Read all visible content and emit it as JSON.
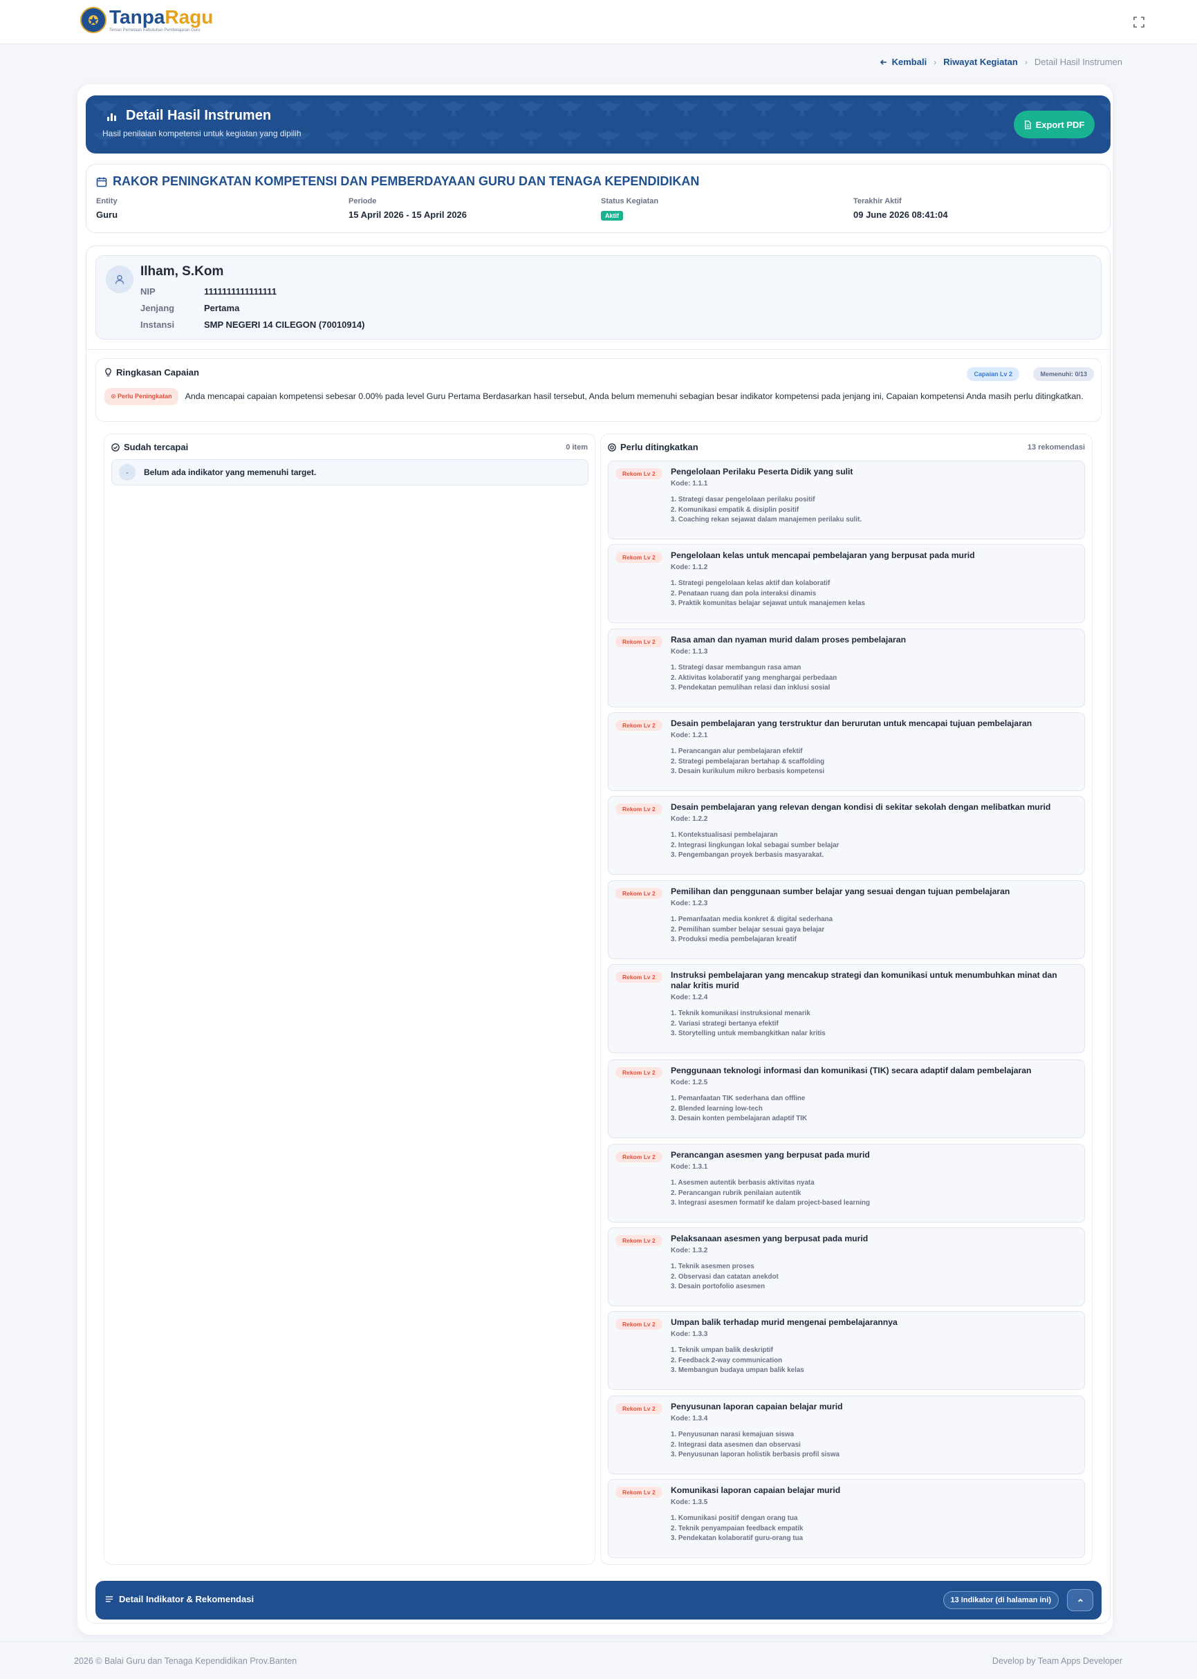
{
  "app": {
    "logo_part1": "Tanpa",
    "logo_part2": "Ragu",
    "logo_sub": "Teman Pemetaan Kebutuhan Pembelajaran Guru"
  },
  "breadcrumb": {
    "back": "Kembali",
    "link": "Riwayat Kegiatan",
    "current": "Detail Hasil Instrumen"
  },
  "banner": {
    "title": "Detail Hasil Instrumen",
    "subtitle": "Hasil penilaian kompetensi untuk kegiatan yang dipilih",
    "export_label": "Export PDF"
  },
  "event": {
    "title": "RAKOR PENINGKATAN KOMPETENSI DAN PEMBERDAYAAN GURU DAN TENAGA KEPENDIDIKAN",
    "entity_label": "Entity",
    "entity_value": "Guru",
    "periode_label": "Periode",
    "periode_value": "15 April 2026 - 15 April 2026",
    "status_label": "Status Kegiatan",
    "status_value": "Aktif",
    "terakhir_label": "Terakhir Aktif",
    "terakhir_value": "09 June 2026 08:41:04"
  },
  "profile": {
    "name": "Ilham, S.Kom",
    "nip_label": "NIP",
    "nip_value": "1111111111111111",
    "jenjang_label": "Jenjang",
    "jenjang_value": "Pertama",
    "instansi_label": "Instansi",
    "instansi_value": "SMP NEGERI 14 CILEGON (70010914)"
  },
  "summary": {
    "title": "Ringkasan Capaian",
    "capaian_pill": "Capaian Lv 2",
    "memenuhi_pill": "Memenuhi: 0/13",
    "status_pill": "Perlu Peningkatan",
    "text": "Anda mencapai capaian kompetensi sebesar 0.00% pada level Guru Pertama Berdasarkan hasil tersebut, Anda belum memenuhi sebagian besar indikator kompetensi pada jenjang ini, Capaian kompetensi Anda masih perlu ditingkatkan."
  },
  "achieved": {
    "title": "Sudah tercapai",
    "count": "0 item",
    "empty_mark": "-",
    "empty_text": "Belum ada indikator yang memenuhi target."
  },
  "improve": {
    "title": "Perlu ditingkatkan",
    "count": "13 rekomendasi",
    "items": [
      {
        "badge": "Rekom Lv 2",
        "title": "Pengelolaan Perilaku Peserta Didik yang sulit",
        "code": "Kode: 1.1.1",
        "points": [
          "1. Strategi dasar pengelolaan perilaku positif",
          "2. Komunikasi empatik & disiplin positif",
          "3. Coaching rekan sejawat dalam manajemen perilaku sulit."
        ]
      },
      {
        "badge": "Rekom Lv 2",
        "title": "Pengelolaan kelas untuk mencapai pembelajaran yang berpusat pada murid",
        "code": "Kode: 1.1.2",
        "points": [
          "1. Strategi pengelolaan kelas aktif dan kolaboratif",
          "2. Penataan ruang dan pola interaksi dinamis",
          "3. Praktik komunitas belajar sejawat untuk manajemen kelas"
        ]
      },
      {
        "badge": "Rekom Lv 2",
        "title": "Rasa aman dan nyaman murid dalam proses pembelajaran",
        "code": "Kode: 1.1.3",
        "points": [
          "1. Strategi dasar membangun rasa aman",
          "2. Aktivitas kolaboratif yang menghargai perbedaan",
          "3. Pendekatan pemulihan relasi dan inklusi sosial"
        ]
      },
      {
        "badge": "Rekom Lv 2",
        "title": "Desain pembelajaran yang terstruktur dan berurutan untuk mencapai tujuan pembelajaran",
        "code": "Kode: 1.2.1",
        "points": [
          "1. Perancangan alur pembelajaran efektif",
          "2. Strategi pembelajaran bertahap & scaffolding",
          "3. Desain kurikulum mikro berbasis kompetensi"
        ]
      },
      {
        "badge": "Rekom Lv 2",
        "title": "Desain pembelajaran yang relevan dengan kondisi di sekitar sekolah dengan melibatkan murid",
        "code": "Kode: 1.2.2",
        "points": [
          "1. Kontekstualisasi pembelajaran",
          "2. Integrasi lingkungan lokal sebagai sumber belajar",
          "3. Pengembangan proyek berbasis masyarakat."
        ]
      },
      {
        "badge": "Rekom Lv 2",
        "title": "Pemilihan dan penggunaan sumber belajar yang sesuai dengan tujuan pembelajaran",
        "code": "Kode: 1.2.3",
        "points": [
          "1. Pemanfaatan media konkret & digital sederhana",
          "2. Pemilihan sumber belajar sesuai gaya belajar",
          "3. Produksi media pembelajaran kreatif"
        ]
      },
      {
        "badge": "Rekom Lv 2",
        "title": "Instruksi pembelajaran yang mencakup strategi dan komunikasi untuk menumbuhkan minat dan nalar kritis murid",
        "code": "Kode: 1.2.4",
        "points": [
          "1. Teknik komunikasi instruksional menarik",
          "2. Variasi strategi bertanya efektif",
          "3. Storytelling untuk membangkitkan nalar kritis"
        ]
      },
      {
        "badge": "Rekom Lv 2",
        "title": "Penggunaan teknologi informasi dan komunikasi (TIK) secara adaptif dalam pembelajaran",
        "code": "Kode: 1.2.5",
        "points": [
          "1. Pemanfaatan TIK sederhana dan offline",
          "2. Blended learning low-tech",
          "3. Desain konten pembelajaran adaptif TIK"
        ]
      },
      {
        "badge": "Rekom Lv 2",
        "title": "Perancangan asesmen yang berpusat pada murid",
        "code": "Kode: 1.3.1",
        "points": [
          "1. Asesmen autentik berbasis aktivitas nyata",
          "2. Perancangan rubrik penilaian autentik",
          "3. Integrasi asesmen formatif ke dalam project-based learning"
        ]
      },
      {
        "badge": "Rekom Lv 2",
        "title": "Pelaksanaan asesmen yang berpusat pada murid",
        "code": "Kode: 1.3.2",
        "points": [
          "1. Teknik asesmen proses",
          "2. Observasi dan catatan anekdot",
          "3. Desain portofolio asesmen"
        ]
      },
      {
        "badge": "Rekom Lv 2",
        "title": "Umpan balik terhadap murid mengenai pembelajarannya",
        "code": "Kode: 1.3.3",
        "points": [
          "1. Teknik umpan balik deskriptif",
          "2. Feedback 2-way communication",
          "3. Membangun budaya umpan balik kelas"
        ]
      },
      {
        "badge": "Rekom Lv 2",
        "title": "Penyusunan laporan capaian belajar murid",
        "code": "Kode: 1.3.4",
        "points": [
          "1. Penyusunan narasi kemajuan siswa",
          "2. Integrasi data asesmen dan observasi",
          "3. Penyusunan laporan holistik berbasis profil siswa"
        ]
      },
      {
        "badge": "Rekom Lv 2",
        "title": "Komunikasi laporan capaian belajar murid",
        "code": "Kode: 1.3.5",
        "points": [
          "1. Komunikasi positif dengan orang tua",
          "2. Teknik penyampaian feedback empatik",
          "3. Pendekatan kolaboratif guru-orang tua"
        ]
      }
    ]
  },
  "bottom_bar": {
    "title": "Detail Indikator & Rekomendasi",
    "count": "13 Indikator (di halaman ini)"
  },
  "footer": {
    "left": "2026 © Balai Guru dan Tenaga Kependidikan Prov.Banten",
    "right": "Develop by Team Apps Developer"
  },
  "colors": {
    "primary": "#1f4f8f",
    "accent": "#19b394",
    "brand_gold": "#e6a21c",
    "warning": "#e0523f"
  }
}
